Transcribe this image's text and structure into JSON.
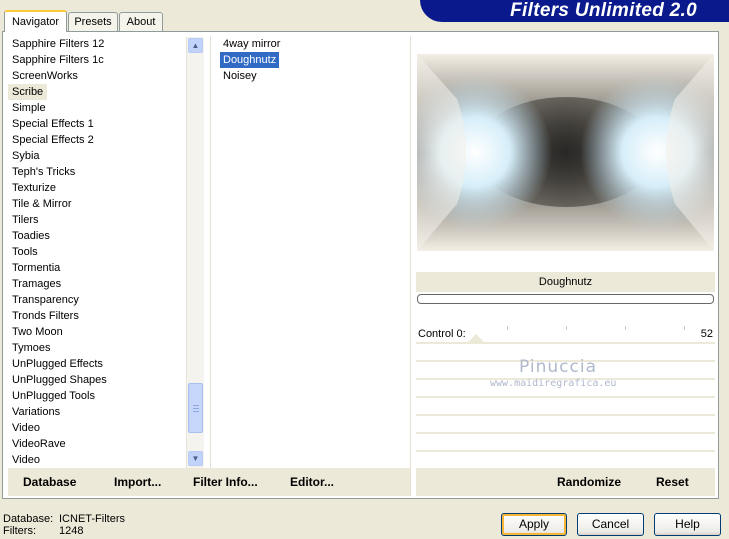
{
  "banner": {
    "title": "Filters Unlimited 2.0"
  },
  "tabs": [
    {
      "label": "Navigator",
      "active": true
    },
    {
      "label": "Presets",
      "active": false
    },
    {
      "label": "About",
      "active": false
    }
  ],
  "categories": [
    {
      "label": "Sapphire Filters 12"
    },
    {
      "label": "Sapphire Filters 1c"
    },
    {
      "label": "ScreenWorks"
    },
    {
      "label": "Scribe",
      "selected": true
    },
    {
      "label": "Simple"
    },
    {
      "label": "Special Effects 1"
    },
    {
      "label": "Special Effects 2"
    },
    {
      "label": "Sybia"
    },
    {
      "label": "Teph's Tricks"
    },
    {
      "label": "Texturize"
    },
    {
      "label": "Tile & Mirror"
    },
    {
      "label": "Tilers"
    },
    {
      "label": "Toadies"
    },
    {
      "label": "Tools"
    },
    {
      "label": "Tormentia"
    },
    {
      "label": "Tramages"
    },
    {
      "label": "Transparency"
    },
    {
      "label": "Tronds Filters"
    },
    {
      "label": "Two Moon"
    },
    {
      "label": "Tymoes"
    },
    {
      "label": "UnPlugged Effects"
    },
    {
      "label": "UnPlugged Shapes"
    },
    {
      "label": "UnPlugged Tools"
    },
    {
      "label": "Variations"
    },
    {
      "label": "Video"
    },
    {
      "label": "VideoRave"
    },
    {
      "label": "Video"
    }
  ],
  "filters": [
    {
      "label": "4way mirror"
    },
    {
      "label": "Doughnutz",
      "selected": true
    },
    {
      "label": "Noisey"
    }
  ],
  "preview": {
    "filter_name": "Doughnutz"
  },
  "control": {
    "label": "Control 0:",
    "value": "52"
  },
  "watermark": {
    "name": "Pinuccia",
    "url": "www.maidiregrafica.eu"
  },
  "bottom_buttons": {
    "database": "Database",
    "import": "Import...",
    "filter_info": "Filter Info...",
    "editor": "Editor...",
    "randomize": "Randomize",
    "reset": "Reset"
  },
  "status": {
    "database_label": "Database:",
    "database_value": "ICNET-Filters",
    "filters_label": "Filters:",
    "filters_value": "1248"
  },
  "dialog": {
    "apply": "Apply",
    "cancel": "Cancel",
    "help": "Help"
  },
  "colors": {
    "banner": "#0a1a8c",
    "selection": "#316ac5",
    "face": "#ece9d8"
  }
}
